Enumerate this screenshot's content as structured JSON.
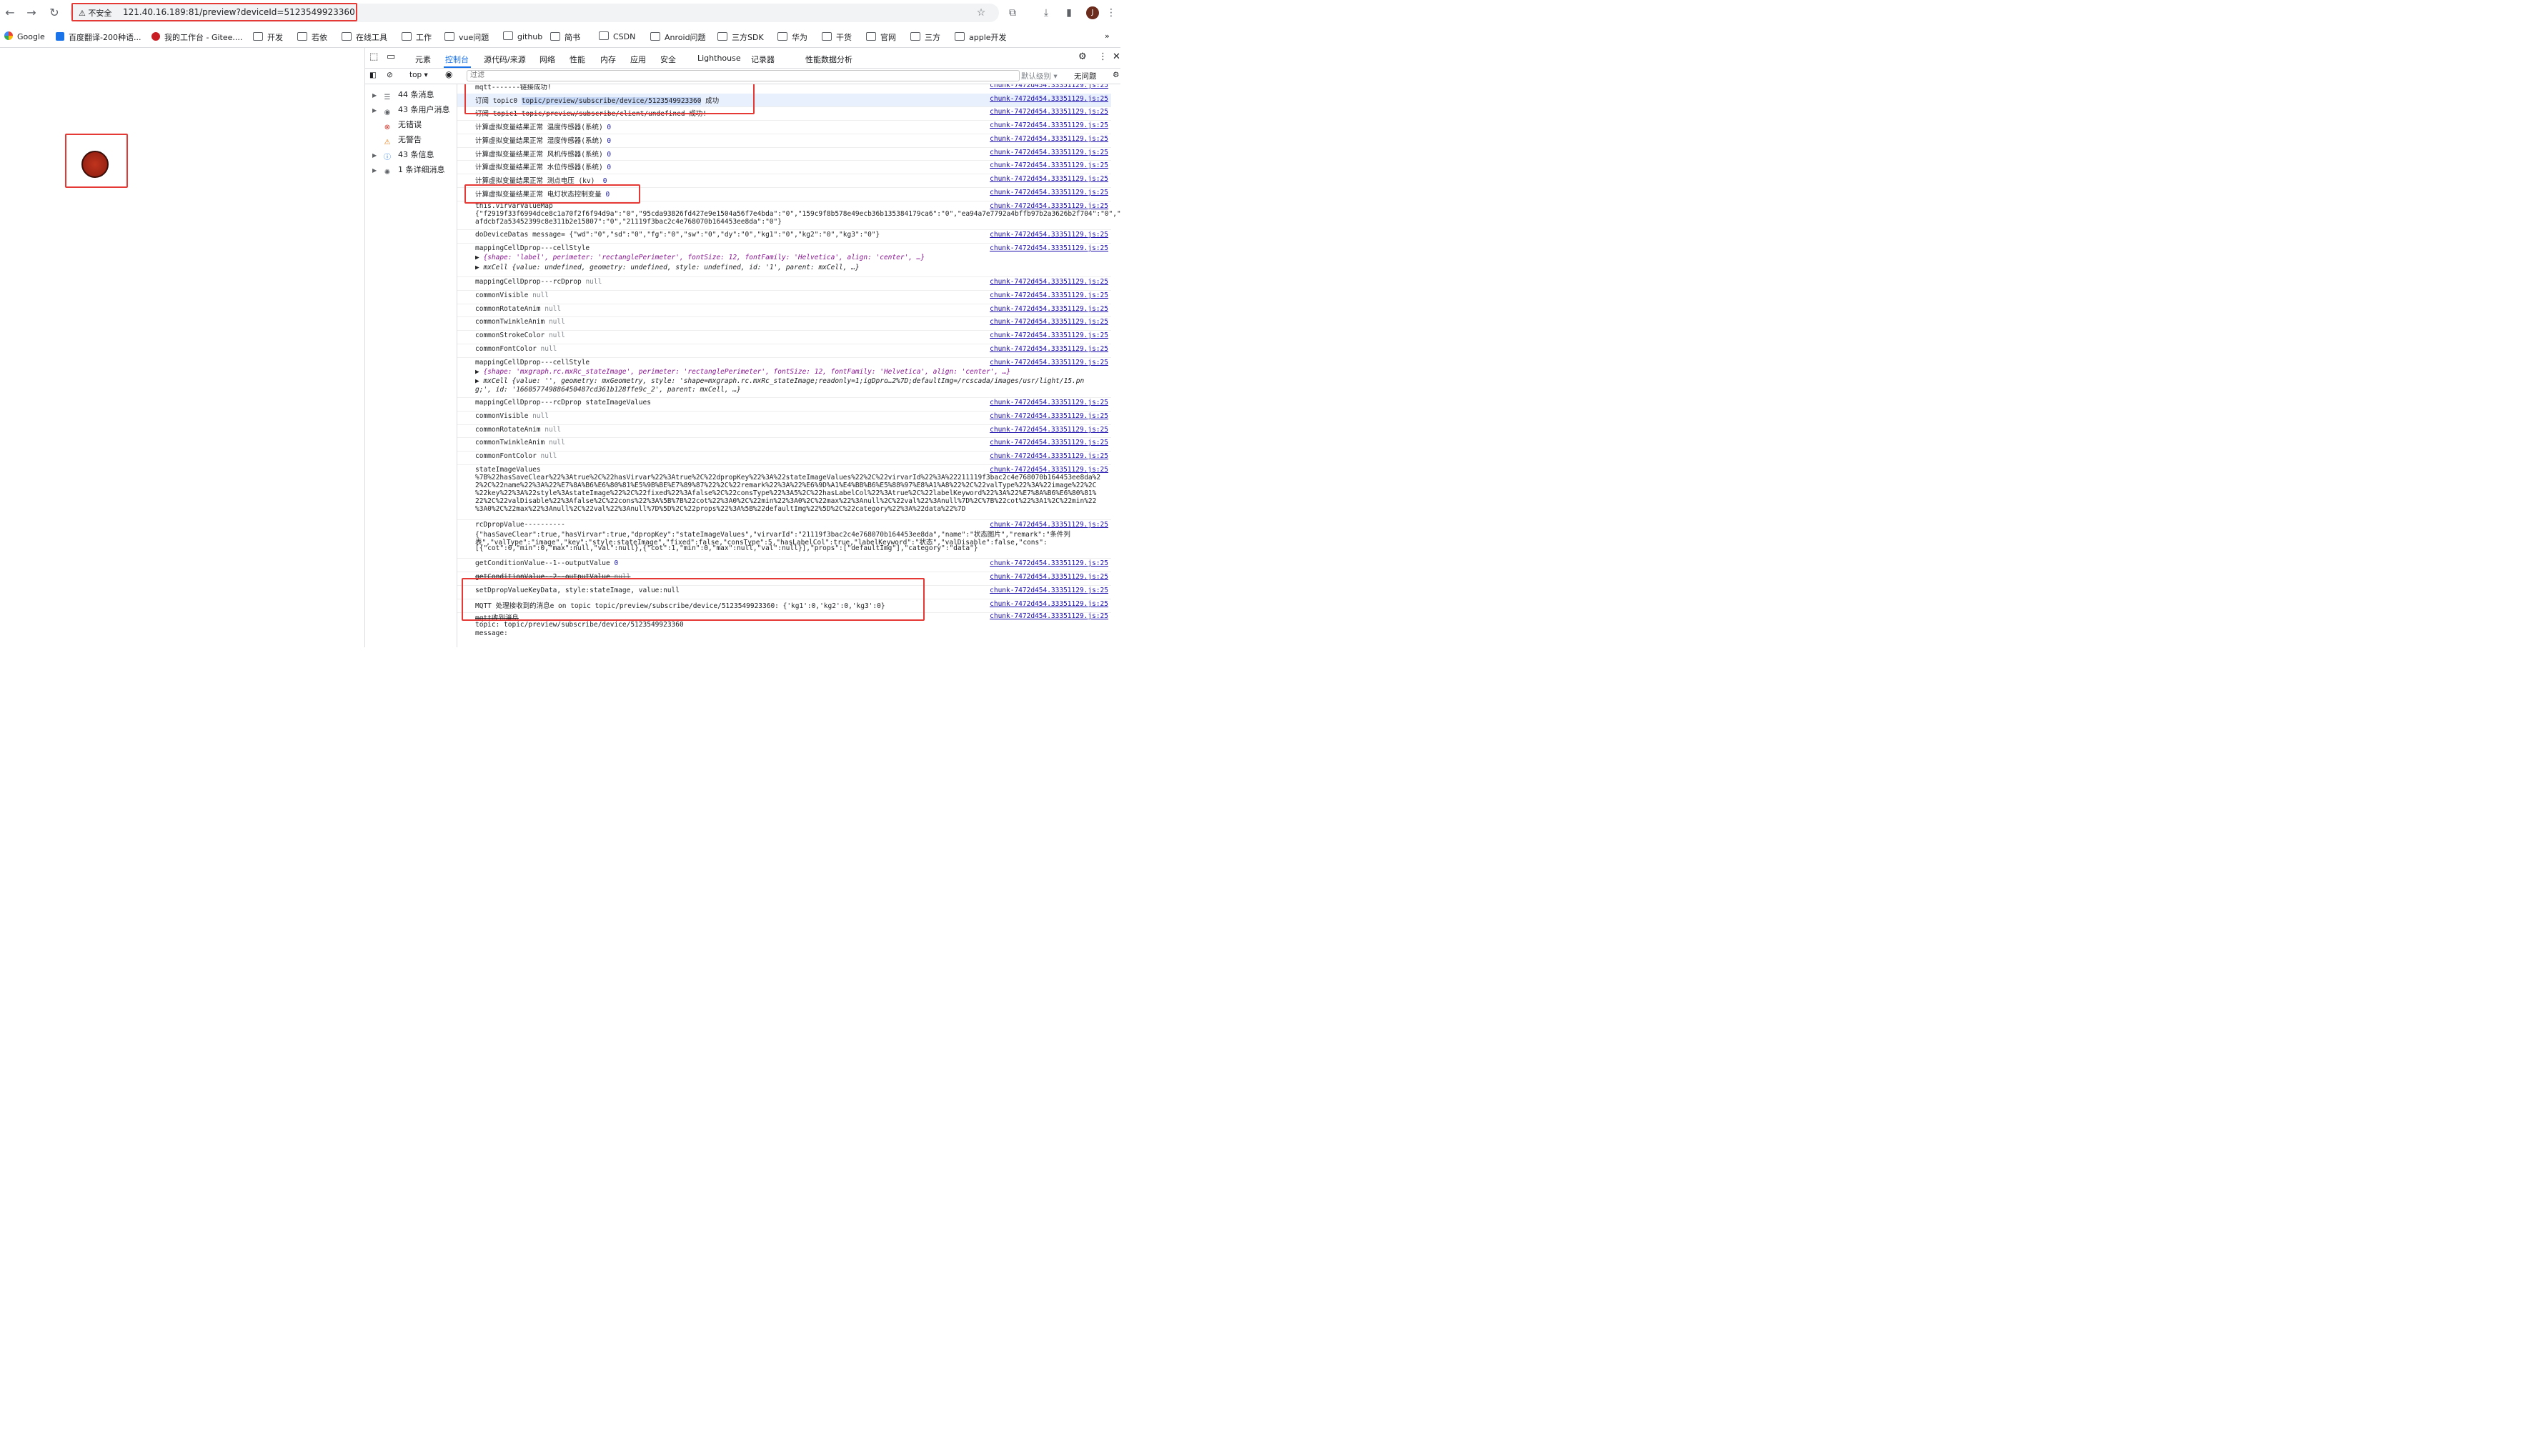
{
  "browser": {
    "security_label": "不安全",
    "url": "121.40.16.189:81/preview?deviceId=5123549923360",
    "avatar_letter": "J"
  },
  "bookmarks": [
    {
      "label": "Google",
      "icon": "google-icon"
    },
    {
      "label": "百度翻译-200种语...",
      "icon": "translate-icon"
    },
    {
      "label": "我的工作台 - Gitee....",
      "icon": "gitee-icon"
    },
    {
      "label": "开发",
      "icon": "folder-icon"
    },
    {
      "label": "若依",
      "icon": "folder-icon"
    },
    {
      "label": "在线工具",
      "icon": "folder-icon"
    },
    {
      "label": "工作",
      "icon": "folder-icon"
    },
    {
      "label": "vue问题",
      "icon": "folder-icon"
    },
    {
      "label": "github",
      "icon": "folder-icon"
    },
    {
      "label": "简书",
      "icon": "folder-icon"
    },
    {
      "label": "CSDN",
      "icon": "folder-icon"
    },
    {
      "label": "Anroid问题",
      "icon": "folder-icon"
    },
    {
      "label": "三方SDK",
      "icon": "folder-icon"
    },
    {
      "label": "华为",
      "icon": "folder-icon"
    },
    {
      "label": "干货",
      "icon": "folder-icon"
    },
    {
      "label": "官网",
      "icon": "folder-icon"
    },
    {
      "label": "三方",
      "icon": "folder-icon"
    },
    {
      "label": "apple开发",
      "icon": "folder-icon"
    }
  ],
  "devtools": {
    "tabs": [
      "元素",
      "控制台",
      "源代码/来源",
      "网络",
      "性能",
      "内存",
      "应用",
      "安全",
      "Lighthouse",
      "记录器",
      "性能数据分析"
    ],
    "active_tab": "控制台",
    "context": "top",
    "filter_placeholder": "过滤",
    "level": "默认级别",
    "issues": "无问题",
    "sidebar": [
      {
        "label": "44 条消息",
        "icon": "list-icon",
        "expandable": true
      },
      {
        "label": "43 条用户消息",
        "icon": "user-icon",
        "expandable": true
      },
      {
        "label": "无错误",
        "icon": "error-icon",
        "expandable": false
      },
      {
        "label": "无警告",
        "icon": "warning-icon",
        "expandable": false
      },
      {
        "label": "43 条信息",
        "icon": "info-icon",
        "expandable": true
      },
      {
        "label": "1 条详细消息",
        "icon": "bug-icon",
        "expandable": true
      }
    ]
  },
  "console": {
    "source": "chunk-7472d454.33351129.js:25",
    "lines": {
      "l0": "mqtt-------链接成功!",
      "l1a": "订阅 topic0 ",
      "l1b": "topic/preview/subscribe/device/5123549923360",
      "l1c": " 成功",
      "l2": "订阅 topic1 topic/preview/subscribe/client/undefined 成功!",
      "l3": "计算虚拟变量结果正常 温度传感器(系统) ",
      "l4": "计算虚拟变量结果正常 湿度传感器(系统) ",
      "l5": "计算虚拟变量结果正常 风机传感器(系统) ",
      "l6": "计算虚拟变量结果正常 水位传感器(系统) ",
      "l7": "计算虚拟变量结果正常 测点电压 (kv)  ",
      "l8": "计算虚拟变量结果正常 电灯状态控制变量 ",
      "zero": "0",
      "l9a": "this.virvarValueMap",
      "l9b": "{\"f2919f33f6994dce8c1a70f2f6f94d9a\":\"0\",\"95cda93826fd427e9e1504a56f7e4bda\":\"0\",\"159c9f8b578e49ecb36b135384179ca6\":\"0\",\"ea94a7e7792a4bffb97b2a3626b2f704\":\"0\",\"0d",
      "l9c": "afdcbf2a53452399c8e311b2e15807\":\"0\",\"21119f3bac2c4e768070b164453ee8da\":\"0\"}",
      "l10": "doDeviceDatas message= {\"wd\":\"0\",\"sd\":\"0\",\"fg\":\"0\",\"sw\":\"0\",\"dy\":\"0\",\"kg1\":\"0\",\"kg2\":\"0\",\"kg3\":\"0\"}",
      "l11a": "mappingCellDprop---cellStyle",
      "l11b": "{shape: 'label', perimeter: 'rectanglePerimeter', fontSize: 12, fontFamily: 'Helvetica', align: 'center', …}",
      "l11c": "mxCell {value: undefined, geometry: undefined, style: undefined, id: '1', parent: mxCell, …}",
      "l12": "mappingCellDprop---rcDprop ",
      "null": "null",
      "l13": "commonVisible ",
      "l14": "commonRotateAnim ",
      "l15": "commonTwinkleAnim ",
      "l16": "commonStrokeColor ",
      "l17": "commonFontColor ",
      "l18a": "mappingCellDprop---cellStyle",
      "l18b": "{shape: 'mxgraph.rc.mxRc_stateImage', perimeter: 'rectanglePerimeter', fontSize: 12, fontFamily: 'Helvetica', align: 'center', …}",
      "l18c": "mxCell {value: '', geometry: mxGeometry, style: 'shape=mxgraph.rc.mxRc_stateImage;readonly=1;igDpro…2%7D;defaultImg=/rcscada/images/usr/light/15.pn",
      "l18d": "g;', id: '166057749886450487cd361b128ffe9c_2', parent: mxCell, …}",
      "l19": "mappingCellDprop---rcDprop stateImageValues",
      "l20": "commonVisible ",
      "l21": "commonRotateAnim ",
      "l22": "commonTwinkleAnim ",
      "l23": "commonFontColor ",
      "l24a": "stateImageValues",
      "l24b": "%7B%22hasSaveClear%22%3Atrue%2C%22hasVirvar%22%3Atrue%2C%22dpropKey%22%3A%22stateImageValues%22%2C%22virvarId%22%3A%22211119f3bac2c4e768070b164453ee8da%2",
      "l24c": "2%2C%22name%22%3A%22%E7%8A%B6%E6%80%81%E5%9B%BE%E7%89%87%22%2C%22remark%22%3A%22%E6%9D%A1%E4%BB%B6%E5%88%97%E8%A1%A8%22%2C%22valType%22%3A%22image%22%2C",
      "l24d": "%22key%22%3A%22style%3AstateImage%22%2C%22fixed%22%3Afalse%2C%22consType%22%3A5%2C%22hasLabelCol%22%3Atrue%2C%22labelKeyword%22%3A%22%E7%8A%B6%E6%80%81%",
      "l24e": "22%2C%22valDisable%22%3Afalse%2C%22cons%22%3A%5B%7B%22cot%22%3A0%2C%22min%22%3A0%2C%22max%22%3Anull%2C%22val%22%3Anull%7D%2C%7B%22cot%22%3A1%2C%22min%22",
      "l24f": "%3A0%2C%22max%22%3Anull%2C%22val%22%3Anull%7D%5D%2C%22props%22%3A%5B%22defaultImg%22%5D%2C%22category%22%3A%22data%22%7D",
      "l25a": "rcDpropValue----------",
      "l25b": "{\"hasSaveClear\":true,\"hasVirvar\":true,\"dpropKey\":\"stateImageValues\",\"virvarId\":\"21119f3bac2c4e768070b164453ee8da\",\"name\":\"状态图片\",\"remark\":\"条件列",
      "l25c": "表\",\"valType\":\"image\",\"key\":\"style:stateImage\",\"fixed\":false,\"consType\":5,\"hasLabelCol\":true,\"labelKeyword\":\"状态\",\"valDisable\":false,\"cons\":",
      "l25d": "[{\"cot\":0,\"min\":0,\"max\":null,\"val\":null},{\"cot\":1,\"min\":0,\"max\":null,\"val\":null}],\"props\":[\"defaultImg\"],\"category\":\"data\"}",
      "l26": "getConditionValue--1--outputValue ",
      "l27": "getConditionValue--2--outputValue ",
      "l28": "setDpropValueKeyData, style:stateImage, value:null",
      "l29": "MQTT 处理接收到的消息e on topic topic/preview/subscribe/device/5123549923360: {'kg1':0,'kg2':0,'kg3':0}",
      "l30a": "mqtt收到消息",
      "l30b": "topic: topic/preview/subscribe/device/5123549923360",
      "l30c": "message:"
    }
  },
  "colors": {
    "highlight": "#e53935",
    "accent": "#1a73e8",
    "lamp": "#a8281a"
  }
}
